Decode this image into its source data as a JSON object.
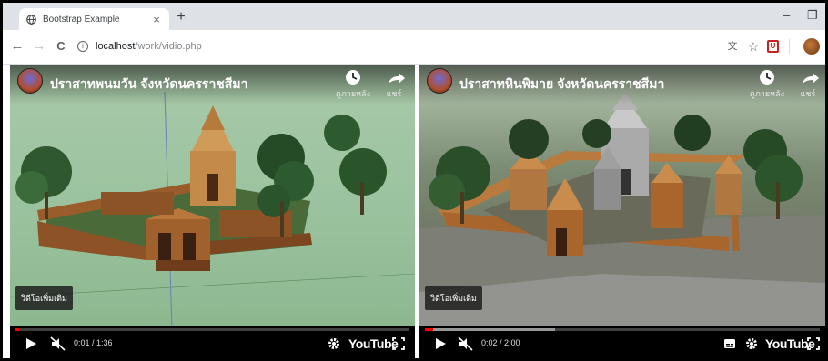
{
  "browser": {
    "tab_title": "Bootstrap Example",
    "tab_close": "×",
    "new_tab": "+",
    "minimize": "–",
    "restore": "❐",
    "url_host": "localhost",
    "url_path": "/work/vidio.php",
    "info_icon": "i",
    "back": "←",
    "forward": "→",
    "reload": "C",
    "translate_icon": "文",
    "bookmark_icon": "☆",
    "pdf_ext_label": "U"
  },
  "players": [
    {
      "title": "ปราสาทพนมวัน จังหวัดนครราชสีมา",
      "watch_later": "ดูภายหลัง",
      "share": "แชร์",
      "more_videos": "วิดีโอเพิ่มเติม",
      "time": "0:01 / 1:36",
      "progress": 0.01,
      "buffer": 0.01,
      "youtube": "YouTube"
    },
    {
      "title": "ปราสาทหินพิมาย จังหวัดนครราชสีมา",
      "watch_later": "ดูภายหลัง",
      "share": "แชร์",
      "more_videos": "วิดีโอเพิ่มเติม",
      "time": "0:02 / 2:00",
      "progress": 0.02,
      "buffer": 0.33,
      "youtube": "YouTube"
    }
  ],
  "colors": {
    "progress_played": "#ff0000",
    "scene1_ground": "#9cc39f",
    "scene2_ground": "#6f7463",
    "temple_brick": "#a0612c"
  }
}
